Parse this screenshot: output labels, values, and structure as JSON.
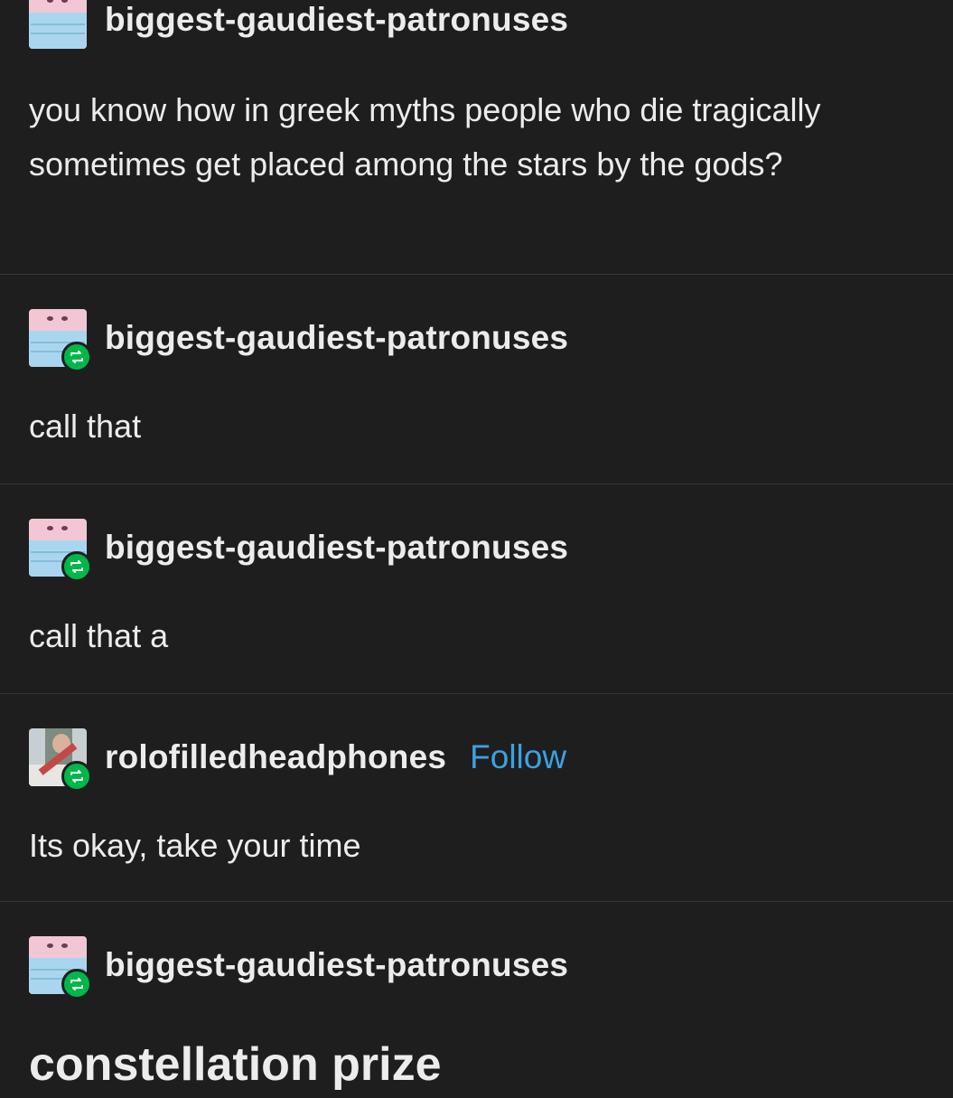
{
  "posts": [
    {
      "username": "biggest-gaudiest-patronuses",
      "text": "you know how in greek myths people who die tragically sometimes get placed among the stars by the gods?",
      "avatar_icon": "face-mask-avatar-icon",
      "reblog": false
    },
    {
      "username": "biggest-gaudiest-patronuses",
      "text": "call that",
      "avatar_icon": "face-mask-avatar-icon",
      "reblog": true
    },
    {
      "username": "biggest-gaudiest-patronuses",
      "text": "call that a",
      "avatar_icon": "face-mask-avatar-icon",
      "reblog": true
    },
    {
      "username": "rolofilledheadphones",
      "follow_label": "Follow",
      "text": "Its okay, take your time",
      "avatar_icon": "photo-avatar-icon",
      "reblog": true
    },
    {
      "username": "biggest-gaudiest-patronuses",
      "text": "constellation prize",
      "avatar_icon": "face-mask-avatar-icon",
      "reblog": true
    }
  ],
  "colors": {
    "background": "#1e1e1f",
    "text": "#ececec",
    "follow": "#3ba2e0",
    "reblog_badge": "#00b84a",
    "divider": "#353536"
  }
}
